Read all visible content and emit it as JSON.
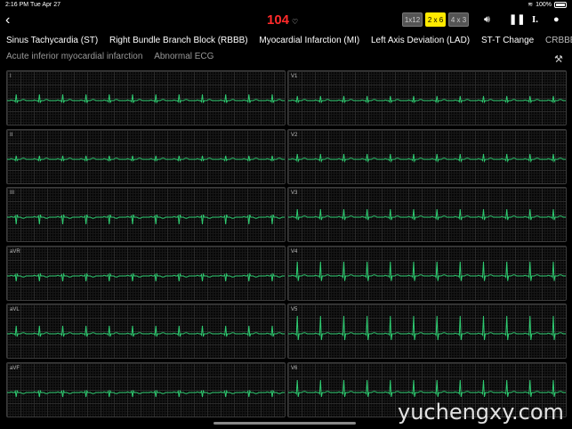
{
  "status_bar": {
    "time": "2:16 PM",
    "date": "Tue Apr 27",
    "battery": "100%"
  },
  "header": {
    "heart_rate": "104",
    "layouts": [
      {
        "label": "1x12",
        "active": false
      },
      {
        "label": "2 x 6",
        "active": true
      },
      {
        "label": "4 x 3",
        "active": false
      }
    ]
  },
  "diagnoses": {
    "row1": [
      "Sinus Tachycardia (ST)",
      "Right Bundle Branch Block (RBBB)",
      "Myocardial Infarction (MI)",
      "Left Axis Deviation (LAD)",
      "ST-T Change",
      "CRBBB"
    ],
    "row2": [
      "Acute inferior myocardial infarction",
      "Abnormal ECG"
    ]
  },
  "leads": [
    {
      "label": "I",
      "amplitude": 7,
      "polarity": 1
    },
    {
      "label": "V1",
      "amplitude": 5,
      "polarity": 1
    },
    {
      "label": "II",
      "amplitude": 4,
      "polarity": 1
    },
    {
      "label": "V2",
      "amplitude": 6,
      "polarity": 1
    },
    {
      "label": "III",
      "amplitude": 8,
      "polarity": -1
    },
    {
      "label": "V3",
      "amplitude": 9,
      "polarity": 1
    },
    {
      "label": "aVR",
      "amplitude": 6,
      "polarity": -1
    },
    {
      "label": "V4",
      "amplitude": 16,
      "polarity": 1
    },
    {
      "label": "aVL",
      "amplitude": 9,
      "polarity": 1
    },
    {
      "label": "V5",
      "amplitude": 20,
      "polarity": 1
    },
    {
      "label": "aVF",
      "amplitude": 5,
      "polarity": -1
    },
    {
      "label": "V6",
      "amplitude": 14,
      "polarity": 1
    }
  ],
  "beats_per_strip": 12,
  "watermark": "yuchengxy.com",
  "colors": {
    "trace": "#2ecc71",
    "heart_rate": "#ff2a2a",
    "active_layout": "#ffea00"
  }
}
